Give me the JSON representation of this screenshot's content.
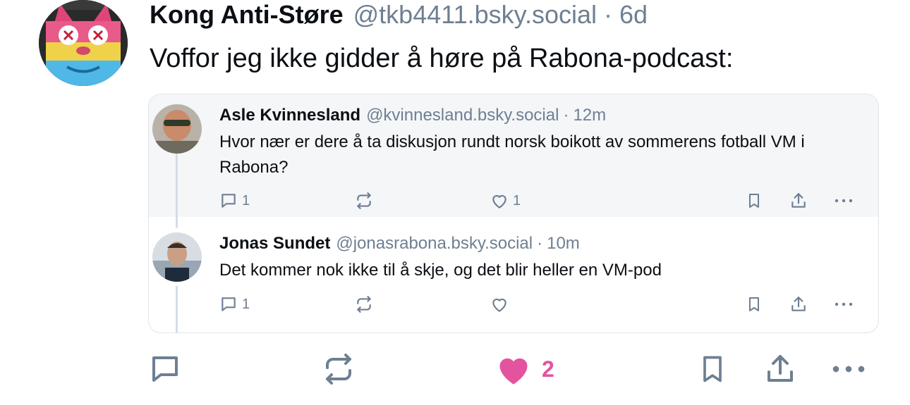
{
  "post": {
    "author_name": "Kong Anti-Støre",
    "author_handle": "@tkb4411.bsky.social",
    "separator": "·",
    "time": "6d",
    "text": "Voffor jeg ikke gidder å høre på Rabona-podcast:",
    "avatar_icon": "cartoon-cat-avatar",
    "actions": {
      "reply_icon": "reply-bubble-icon",
      "repost_icon": "repost-icon",
      "like_icon": "heart-filled-icon",
      "like_count": "2",
      "like_color": "#e4539e",
      "bookmark_icon": "bookmark-icon",
      "share_icon": "share-icon",
      "more_icon": "more-dots-icon"
    }
  },
  "quote": {
    "items": [
      {
        "author_name": "Asle Kvinnesland",
        "author_handle": "@kvinnesland.bsky.social",
        "separator": "·",
        "time": "12m",
        "text": "Hvor nær er dere å ta diskusjon rundt norsk boikott av sommerens fotball VM i Rabona?",
        "reply_count": "1",
        "like_count": "1"
      },
      {
        "author_name": "Jonas Sundet",
        "author_handle": "@jonasrabona.bsky.social",
        "separator": "·",
        "time": "10m",
        "text": "Det kommer nok ikke til å skje, og det blir heller en VM-pod",
        "reply_count": "1",
        "like_count": ""
      }
    ]
  },
  "colors": {
    "text_primary": "#0b0f14",
    "text_secondary": "#6f7f92",
    "like_pink": "#e4539e",
    "card_border": "#dfe5ec",
    "highlight_bg": "#f4f6f8"
  }
}
